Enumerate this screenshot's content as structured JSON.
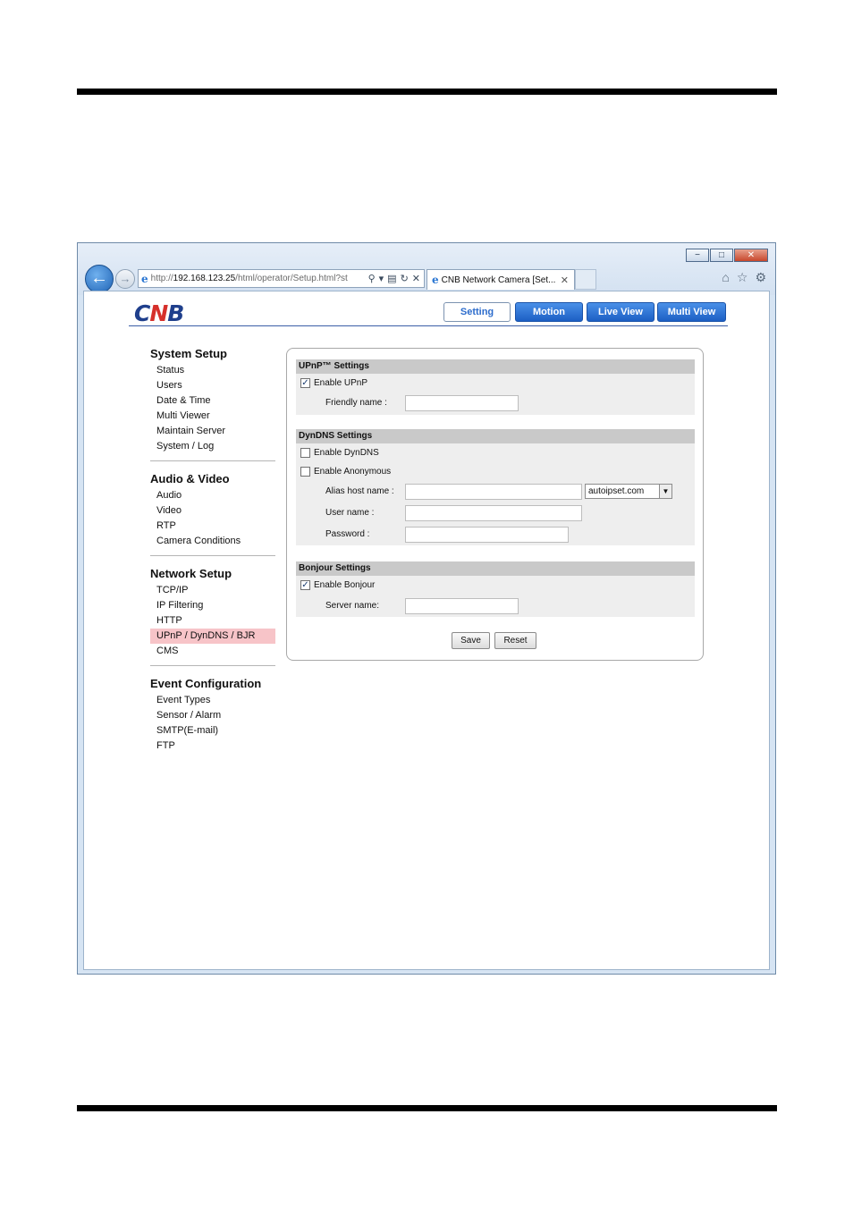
{
  "browser": {
    "address": {
      "prefix": "http://",
      "host": "192.168.123.25",
      "path": "/html/operator/Setup.html?st"
    },
    "tab_title": "CNB Network Camera [Set...",
    "window_controls": [
      "−",
      "□",
      "✕"
    ]
  },
  "header": {
    "logo_left": "C",
    "logo_mid": "N",
    "logo_right": "B",
    "nav": [
      "Setting",
      "Motion",
      "Live View",
      "Multi View"
    ]
  },
  "sidebar": {
    "sections": [
      {
        "title": "System Setup",
        "items": [
          "Status",
          "Users",
          "Date & Time",
          "Multi Viewer",
          "Maintain Server",
          "System / Log"
        ]
      },
      {
        "title": "Audio & Video",
        "items": [
          "Audio",
          "Video",
          "RTP",
          "Camera Conditions"
        ]
      },
      {
        "title": "Network Setup",
        "items": [
          "TCP/IP",
          "IP Filtering",
          "HTTP",
          "UPnP / DynDNS / BJR",
          "CMS"
        ]
      },
      {
        "title": "Event Configuration",
        "items": [
          "Event Types",
          "Sensor / Alarm",
          "SMTP(E-mail)",
          "FTP"
        ]
      }
    ],
    "selected_item": "UPnP / DynDNS / BJR"
  },
  "upnp": {
    "title": "UPnP™ Settings",
    "enable_label": "Enable UPnP",
    "enable_checked": true,
    "friendly_name_label": "Friendly name :",
    "friendly_name_value": ""
  },
  "dyndns": {
    "title": "DynDNS Settings",
    "enable_label": "Enable DynDNS",
    "enable_checked": false,
    "anonymous_label": "Enable Anonymous",
    "anonymous_checked": false,
    "alias_label": "Alias host name :",
    "alias_value": "",
    "domain_selected": "autoipset.com",
    "username_label": "User name :",
    "username_value": "",
    "password_label": "Password :",
    "password_value": ""
  },
  "bonjour": {
    "title": "Bonjour Settings",
    "enable_label": "Enable Bonjour",
    "enable_checked": true,
    "server_name_label": "Server name:",
    "server_name_value": ""
  },
  "actions": {
    "save": "Save",
    "reset": "Reset"
  }
}
